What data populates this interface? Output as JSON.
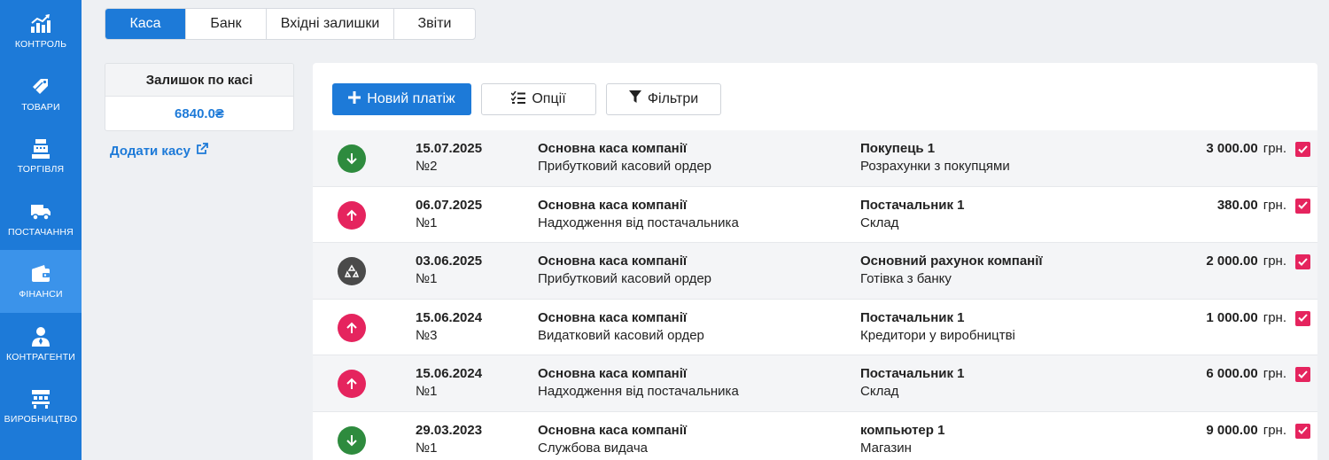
{
  "sidebar": {
    "items": [
      {
        "label": "КОНТРОЛЬ",
        "icon": "chart-icon",
        "active": false
      },
      {
        "label": "ТОВАРИ",
        "icon": "tags-icon",
        "active": false
      },
      {
        "label": "ТОРГІВЛЯ",
        "icon": "cash-register-icon",
        "active": false
      },
      {
        "label": "ПОСТАЧАННЯ",
        "icon": "truck-icon",
        "active": false
      },
      {
        "label": "ФІНАНСИ",
        "icon": "wallet-icon",
        "active": true
      },
      {
        "label": "КОНТРАГЕНТИ",
        "icon": "user-icon",
        "active": false
      },
      {
        "label": "ВИРОБНИЦТВО",
        "icon": "factory-icon",
        "active": false
      }
    ]
  },
  "tabs": [
    {
      "label": "Каса",
      "active": true
    },
    {
      "label": "Банк",
      "active": false
    },
    {
      "label": "Вхідні залишки",
      "active": false
    },
    {
      "label": "Звіти",
      "active": false
    }
  ],
  "balance": {
    "title": "Залишок по касі",
    "value": "6840.0₴"
  },
  "add_kasa_label": "Додати касу",
  "toolbar": {
    "new_payment_label": "Новий платіж",
    "options_label": "Опції",
    "filters_label": "Фільтри"
  },
  "colors": {
    "accent": "#1d7ad8",
    "income": "#2e8b3e",
    "expense": "#e5245e",
    "transfer": "#4a4a4a"
  },
  "payments": [
    {
      "direction": "in",
      "date": "15.07.2025",
      "number": "№2",
      "kasa": "Основна каса компанії",
      "type": "Прибутковий касовий ордер",
      "party": "Покупець 1",
      "category": "Розрахунки з покупцями",
      "amount": "3 000.00",
      "currency": "грн."
    },
    {
      "direction": "out",
      "date": "06.07.2025",
      "number": "№1",
      "kasa": "Основна каса компанії",
      "type": "Надходження від постачальника",
      "party": "Постачальник 1",
      "category": "Склад",
      "amount": "380.00",
      "currency": "грн."
    },
    {
      "direction": "transfer",
      "date": "03.06.2025",
      "number": "№1",
      "kasa": "Основна каса компанії",
      "type": "Прибутковий касовий ордер",
      "party": "Основний рахунок компанії",
      "category": "Готівка з банку",
      "amount": "2 000.00",
      "currency": "грн."
    },
    {
      "direction": "out",
      "date": "15.06.2024",
      "number": "№3",
      "kasa": "Основна каса компанії",
      "type": "Видатковий касовий ордер",
      "party": "Постачальник 1",
      "category": "Кредитори у виробництві",
      "amount": "1 000.00",
      "currency": "грн."
    },
    {
      "direction": "out",
      "date": "15.06.2024",
      "number": "№1",
      "kasa": "Основна каса компанії",
      "type": "Надходження від постачальника",
      "party": "Постачальник 1",
      "category": "Склад",
      "amount": "6 000.00",
      "currency": "грн."
    },
    {
      "direction": "in",
      "date": "29.03.2023",
      "number": "№1",
      "kasa": "Основна каса компанії",
      "type": "Службова видача",
      "party": "компьютер 1",
      "category": "Магазин",
      "amount": "9 000.00",
      "currency": "грн."
    }
  ]
}
